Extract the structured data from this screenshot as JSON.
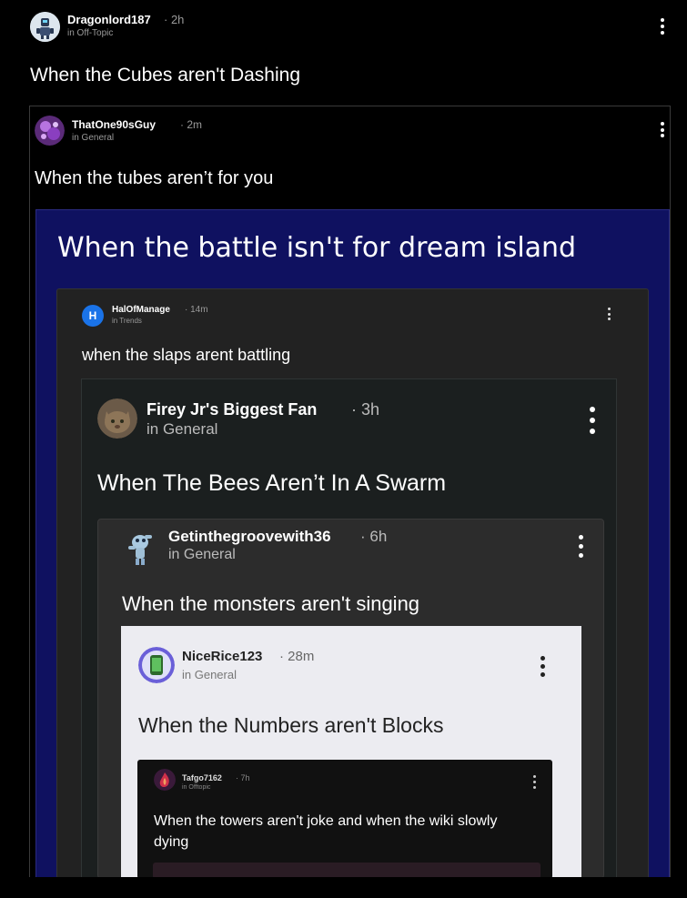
{
  "posts": {
    "p1": {
      "username": "Dragonlord187",
      "time": "· 2h",
      "community": "in Off-Topic",
      "title": "When the Cubes aren't Dashing",
      "avatar_icon": "robot-avatar-icon",
      "menu_icon": "kebab-menu-icon"
    },
    "p2": {
      "username": "ThatOne90sGuy",
      "time": "· 2m",
      "community": "in General",
      "title": "When the tubes aren’t for you",
      "avatar_icon": "purple-splash-avatar-icon",
      "menu_icon": "kebab-menu-icon"
    },
    "p3": {
      "title": "When the battle isn't for dream island",
      "background": "#0f1160"
    },
    "p4": {
      "username": "HalOfManage",
      "time": "· 14m",
      "community": "in Trends",
      "title": "when the slaps arent battling",
      "avatar_letter": "H",
      "avatar_color": "#1a73e8",
      "menu_icon": "kebab-menu-icon"
    },
    "p5": {
      "username": "Firey Jr's Biggest Fan",
      "time": "· 3h",
      "community": "in General",
      "title": "When The Bees Aren’t In A Swarm",
      "avatar_icon": "cat-photo-avatar-icon",
      "menu_icon": "kebab-menu-icon"
    },
    "p6": {
      "username": "Getinthegroovewith36",
      "time": "· 6h",
      "community": "in General",
      "title": "When the monsters aren't singing",
      "avatar_icon": "monster-character-avatar-icon",
      "menu_icon": "kebab-menu-icon"
    },
    "p7": {
      "username": "NiceRice123",
      "time": "· 28m",
      "community": "in General",
      "title": "When the Numbers aren't Blocks",
      "avatar_icon": "green-phone-avatar-icon",
      "menu_icon": "kebab-menu-icon"
    },
    "p8": {
      "username": "Tafgo7162",
      "time": "· 7h",
      "community": "in Offtopic",
      "title": "When the towers aren't joke and when the wiki slowly dying",
      "avatar_icon": "red-flame-avatar-icon",
      "menu_icon": "kebab-menu-icon"
    }
  }
}
